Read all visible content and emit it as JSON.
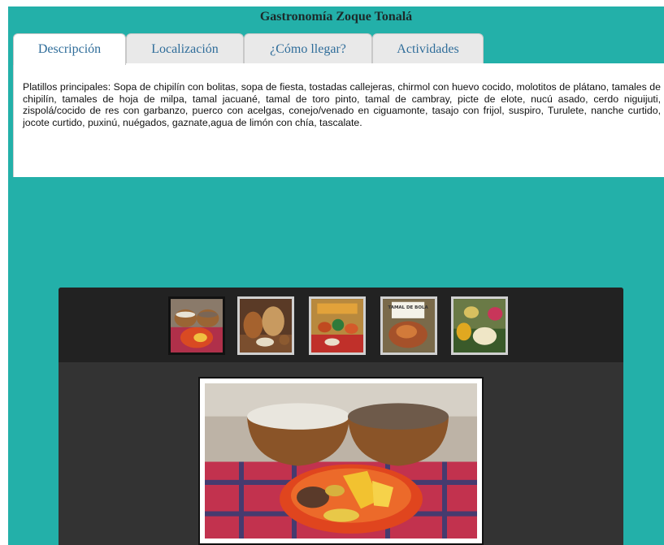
{
  "header": {
    "title": "Gastronomía Zoque Tonalá"
  },
  "tabs": [
    {
      "label": "Descripción",
      "active": true
    },
    {
      "label": "Localización",
      "active": false
    },
    {
      "label": "¿Cómo llegar?",
      "active": false
    },
    {
      "label": "Actividades",
      "active": false
    }
  ],
  "description": {
    "text": "Platillos principales: Sopa de chipilín con bolitas, sopa de fiesta, tostadas callejeras, chirmol con huevo cocido, molotitos de plátano, tamales de chipilín, tamales de hoja de milpa, tamal jacuané, tamal de toro pinto, tamal de cambray, picte de elote, nucú asado, cerdo niguijuti, zispolá/cocido de res con garbanzo, puerco con acelgas, conejo/venado en ciguamonte, tasajo con frijol, suspiro, Turulete, nanche curtido, jocote curtido, puxinú, nuégados, gaznate,agua de limón con chía, tascalate."
  },
  "gallery": {
    "thumbnails": [
      {
        "name": "bowls-and-fruit-thumb",
        "selected": true
      },
      {
        "name": "gourds-thumb",
        "selected": false
      },
      {
        "name": "market-table-thumb",
        "selected": false
      },
      {
        "name": "tamal-de-bola-thumb",
        "caption": "TAMAL DE BOLA",
        "selected": false
      },
      {
        "name": "fruit-spread-thumb",
        "selected": false
      }
    ]
  },
  "colors": {
    "page_background": "#23b0a9",
    "tab_text": "#2f6d9a",
    "gallery_background": "#333333",
    "thumb_strip_background": "#222222"
  }
}
